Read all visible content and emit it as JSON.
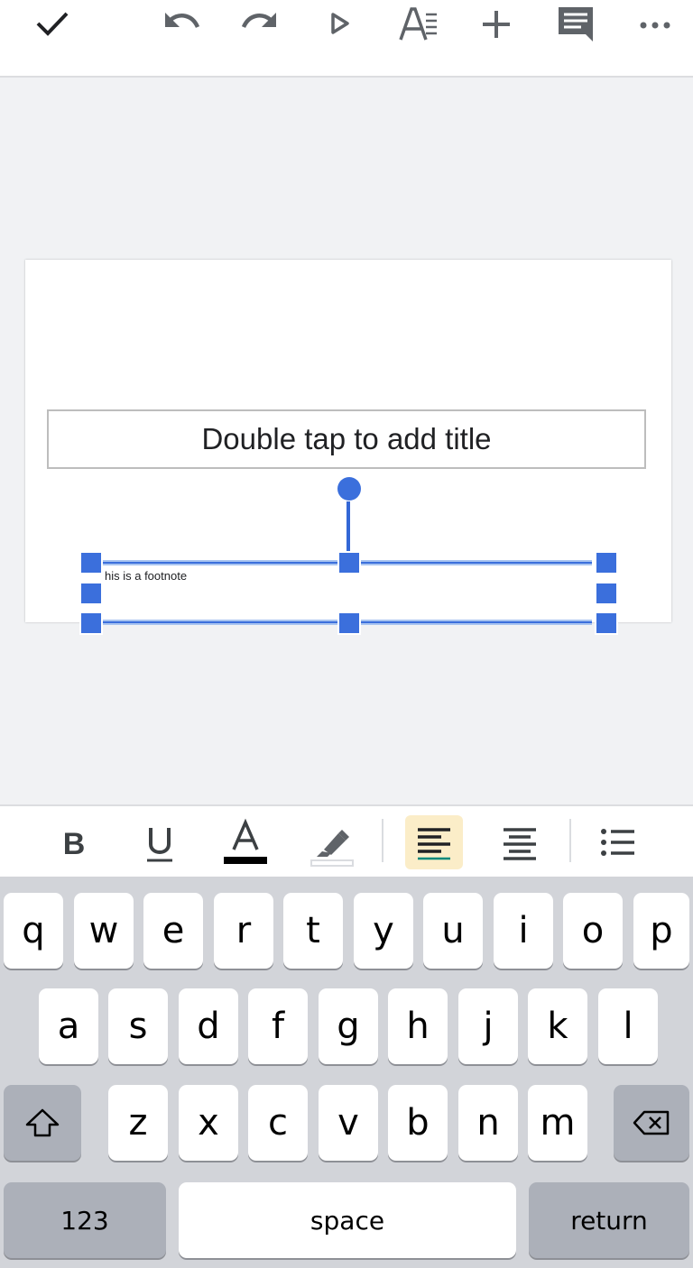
{
  "toolbar": {
    "items": [
      "check-icon",
      "undo-icon",
      "redo-icon",
      "present-icon",
      "text-format-icon",
      "add-icon",
      "comment-icon",
      "more-icon"
    ]
  },
  "slide": {
    "title_placeholder": "Double tap to add title",
    "footnote_text": "his is a footnote"
  },
  "format_bar": {
    "items": [
      "bold-icon",
      "underline-icon",
      "text-color-icon",
      "highlight-icon",
      "align-left-icon",
      "align-center-icon",
      "bulleted-list-icon"
    ],
    "active": "align-left-icon",
    "text_color": "#000000",
    "accent": "#3b6fdc"
  },
  "keyboard": {
    "row1": [
      "q",
      "w",
      "e",
      "r",
      "t",
      "y",
      "u",
      "i",
      "o",
      "p"
    ],
    "row2": [
      "a",
      "s",
      "d",
      "f",
      "g",
      "h",
      "j",
      "k",
      "l"
    ],
    "row3": [
      "z",
      "x",
      "c",
      "v",
      "b",
      "n",
      "m"
    ],
    "numbers_label": "123",
    "space_label": "space",
    "return_label": "return"
  }
}
